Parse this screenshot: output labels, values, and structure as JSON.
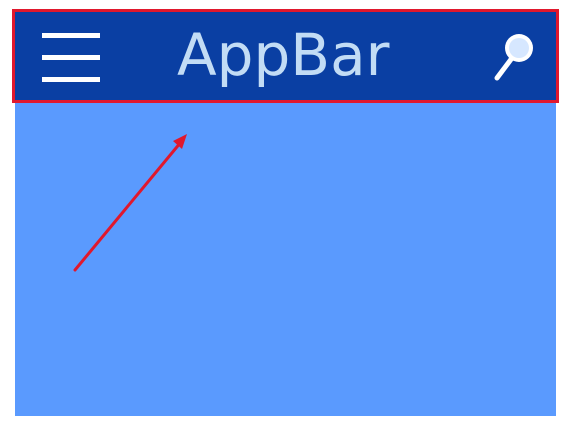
{
  "appbar": {
    "title": "AppBar",
    "menu_icon": "hamburger-menu-icon",
    "search_icon": "search-icon"
  },
  "colors": {
    "appbar_background": "#0a3fa3",
    "content_background": "#5a9afe",
    "title_text": "#c2dcf5",
    "highlight_outline": "#e0182d",
    "arrow": "#e0182d"
  }
}
